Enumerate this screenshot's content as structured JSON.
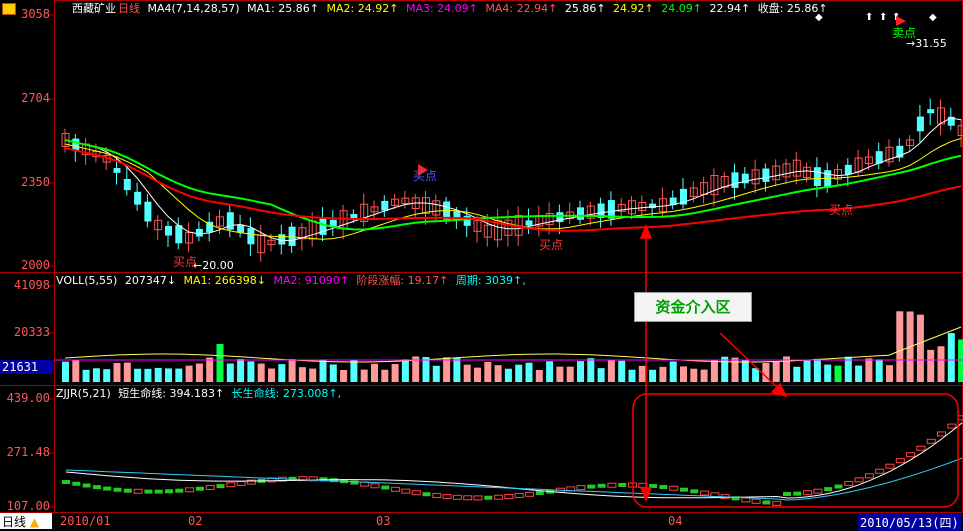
{
  "price_panel": {
    "stock_name": "西藏矿业",
    "period": "日线",
    "ma_header": "MA4(7,14,28,57)",
    "ma1": "MA1: 25.86↑",
    "ma2": "MA2: 24.92↑",
    "ma3": "MA3: 24.09↑",
    "ma4": "MA4: 22.94↑",
    "v1": "25.86↑",
    "v2": "24.92↑",
    "v3": "24.09↑",
    "v4": "22.94↑",
    "close": "收盘: 25.86↑",
    "y_ticks": [
      "3058",
      "2704",
      "2350",
      "2000"
    ],
    "annotations": {
      "buy1": "买点",
      "low": "←20.00",
      "buy2": "买点",
      "buy3": "买点",
      "buy4": "买点",
      "sell_top": "卖点",
      "high": "→31.55"
    }
  },
  "volume_panel": {
    "header": "VOLL(5,55)",
    "val": "207347↓",
    "ma1": "MA1: 266398↓",
    "ma2": "MA2: 91090↑",
    "stage_rise": "阶段涨幅: 19.17↑",
    "period_val": "周期: 3039↑,",
    "y_ticks": [
      "41098",
      "20333"
    ],
    "cursor_value": "21631"
  },
  "zjjr_panel": {
    "header": "ZJJR(5,21)",
    "short_line": "短生命线: 394.183↑",
    "long_line": "长生命线: 273.008↑,",
    "y_ticks": [
      "439.00",
      "271.48",
      "107.00"
    ]
  },
  "callout_label": "资金介入区",
  "x_axis": {
    "period_tab": "日线",
    "labels": [
      "2010/01",
      "02",
      "03",
      "04"
    ],
    "date_readout": "2010/05/13(四)"
  },
  "colors": {
    "up": "#ff5555",
    "down": "#54ffff",
    "ma_white": "#ffffff",
    "ma_yellow": "#ffff00",
    "ma_green": "#00ff00",
    "ma_red": "#ff0000",
    "frame": "#aa0000",
    "callout_green": "#00a000"
  },
  "icons": [
    "up-arrow-icon",
    "diamond-icon",
    "flag-icon"
  ]
}
